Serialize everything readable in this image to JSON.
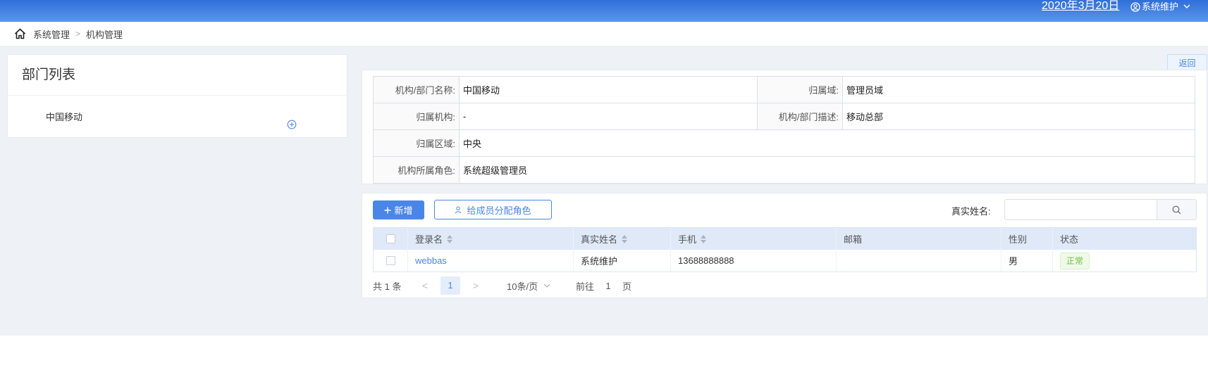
{
  "header": {
    "date": "2020年3月20日",
    "user_name": "系统维护"
  },
  "breadcrumb": {
    "items": [
      "系统管理",
      "机构管理"
    ]
  },
  "dept_panel": {
    "title": "部门列表",
    "items": [
      "中国移动"
    ]
  },
  "actions": {
    "return_label": "返回"
  },
  "org_info": {
    "name_label": "机构/部门名称:",
    "name_value": "中国移动",
    "domain_label": "归属域:",
    "domain_value": "管理员域",
    "parent_label": "归属机构:",
    "parent_value": "-",
    "desc_label": "机构/部门描述:",
    "desc_value": "移动总部",
    "region_label": "归属区域:",
    "region_value": "中央",
    "role_label": "机构所属角色:",
    "role_value": "系统超级管理员"
  },
  "toolbar": {
    "add_label": "新增",
    "assign_label": "给成员分配角色",
    "search_label": "真实姓名:",
    "search_value": ""
  },
  "table": {
    "columns": [
      "登录名",
      "真实姓名",
      "手机",
      "邮箱",
      "性别",
      "状态"
    ],
    "rows": [
      {
        "login": "webbas",
        "real_name": "系统维护",
        "phone": "13688888888",
        "email": "",
        "gender": "男",
        "status": "正常"
      }
    ]
  },
  "pagination": {
    "total": "共 1 条",
    "current_page": "1",
    "page_size": "10条/页",
    "goto_label": "前往",
    "goto_value": "1",
    "page_suffix": "页"
  },
  "colors": {
    "accent": "#4a86e8",
    "header_gradient_top": "#2f6fd8",
    "status_ok": "#67c23a"
  }
}
